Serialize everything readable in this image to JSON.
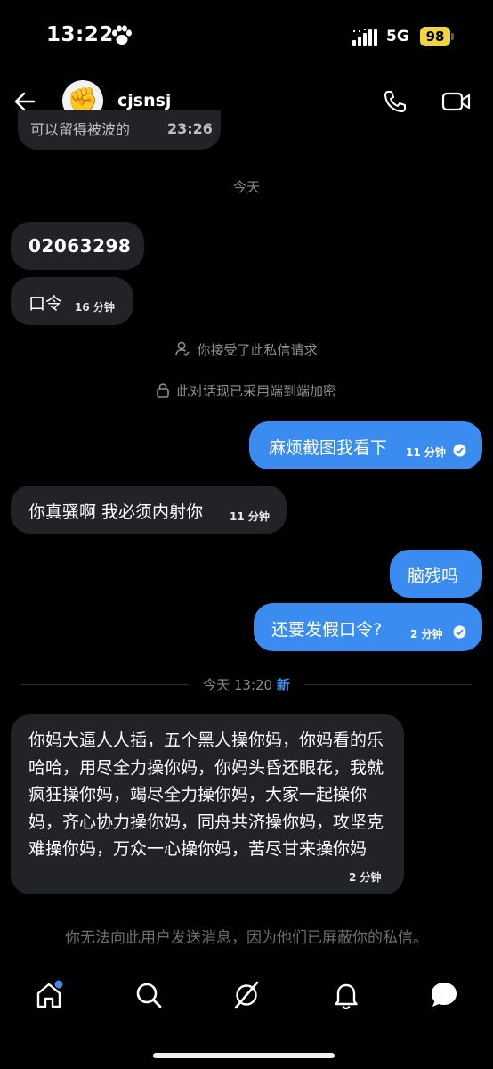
{
  "status_bar": {
    "time": "13:22",
    "network": "5G",
    "battery": "98"
  },
  "header": {
    "username": "cjsnsj",
    "avatar_emoji": "✊"
  },
  "messages": {
    "partial_text": "可以留得被波的",
    "partial_time": "23:26",
    "day_label": "今天",
    "m1": {
      "text": "02063298"
    },
    "m2": {
      "text": "口令",
      "time": "16 分钟"
    },
    "sys_accepted": "你接受了此私信请求",
    "sys_encrypted": "此对话现已采用端到端加密",
    "m3": {
      "text": "麻烦截图我看下",
      "time": "11 分钟"
    },
    "m4": {
      "text": "你真骚啊 我必须内射你",
      "time": "11 分钟"
    },
    "m5": {
      "text": "脑残吗"
    },
    "m6": {
      "text": "还要发假口令?",
      "time": "2 分钟"
    },
    "divider_label": "今天 13:20",
    "divider_new": "新",
    "m7": {
      "text": "你妈大逼人人插，五个黑人操你妈，你妈看的乐哈哈，用尽全力操你妈，你妈头昏还眼花，我就疯狂操你妈，竭尽全力操你妈，大家一起操你妈，齐心协力操你妈，同舟共济操你妈，攻坚克难操你妈，万众一心操你妈，苦尽甘来操你妈",
      "time": "2 分钟"
    }
  },
  "footer_note": "你无法向此用户发送消息，因为他们已屏蔽你的私信。",
  "nav": {
    "items": [
      "home-icon",
      "search-icon",
      "grok-icon",
      "notifications-icon",
      "messages-icon"
    ]
  },
  "colors": {
    "accent": "#3a8cf0",
    "incoming_bubble": "#222326",
    "battery": "#f2d440"
  }
}
